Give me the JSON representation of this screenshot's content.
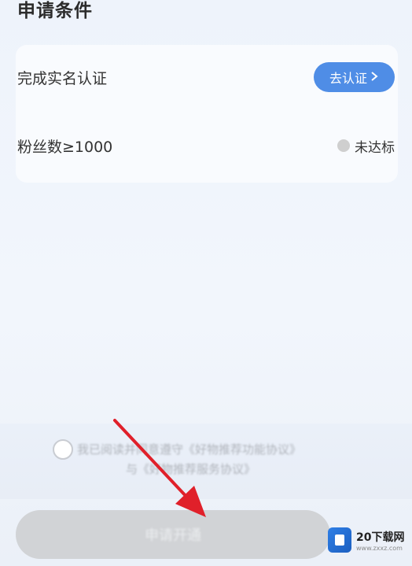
{
  "section": {
    "title": "申请条件"
  },
  "conditions": [
    {
      "label": "完成实名认证",
      "action_label": "去认证",
      "action_icon": "chevron-right-icon"
    },
    {
      "label": "粉丝数≥1000",
      "status_label": "未达标"
    }
  ],
  "agreement": {
    "line1": "我已阅读并同意遵守《好物推荐功能协议》",
    "line2": "与《好物推荐服务协议》"
  },
  "apply_button": {
    "label": "申请开通"
  },
  "annotation": {
    "arrow_color": "#e0202a"
  },
  "watermark": {
    "name": "20下载网",
    "url": "www.zxxz.com"
  },
  "colors": {
    "accent": "#4f8de6",
    "disabled_button": "#d1d3d6"
  }
}
